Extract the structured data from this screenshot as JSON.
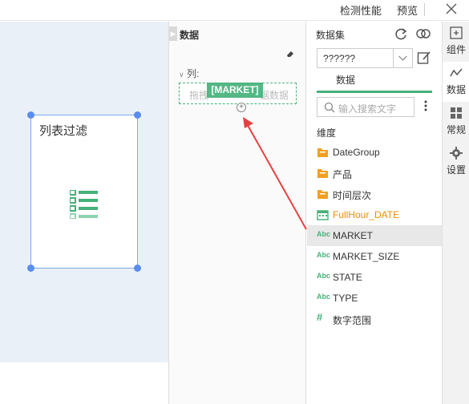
{
  "topbar": {
    "check_label": "检测性能",
    "preview_label": "预览"
  },
  "canvas": {
    "widget_title": "列表过滤"
  },
  "data_panel": {
    "title": "数据",
    "column_label": "列:",
    "dropzone_left": "拖拽",
    "dropzone_right": "据数据",
    "drag_tag": "[MARKET]"
  },
  "dataset_panel": {
    "label": "数据集",
    "selected_dataset": "??????",
    "tab_label": "数据",
    "search_placeholder": "输入搜索文字",
    "dimension_label": "维度",
    "fields": [
      {
        "name": "DateGroup",
        "icon": "folder-icon"
      },
      {
        "name": "产品",
        "icon": "folder-icon"
      },
      {
        "name": "时间层次",
        "icon": "folder-icon"
      },
      {
        "name": "FullHour_DATE",
        "icon": "calendar-icon"
      },
      {
        "name": "MARKET",
        "icon": "abc-icon"
      },
      {
        "name": "MARKET_SIZE",
        "icon": "abc-icon"
      },
      {
        "name": "STATE",
        "icon": "abc-icon"
      },
      {
        "name": "TYPE",
        "icon": "abc-icon"
      },
      {
        "name": "数字范围",
        "icon": "hash-icon"
      }
    ],
    "selected_field": "MARKET"
  },
  "sidebar": {
    "items": [
      {
        "label": "组件"
      },
      {
        "label": "数据"
      },
      {
        "label": "常规"
      },
      {
        "label": "设置"
      }
    ]
  },
  "colors": {
    "accent": "#46b17a",
    "selection": "#5b8def",
    "orange_field": "#f08c00",
    "arrow": "#e84040"
  }
}
